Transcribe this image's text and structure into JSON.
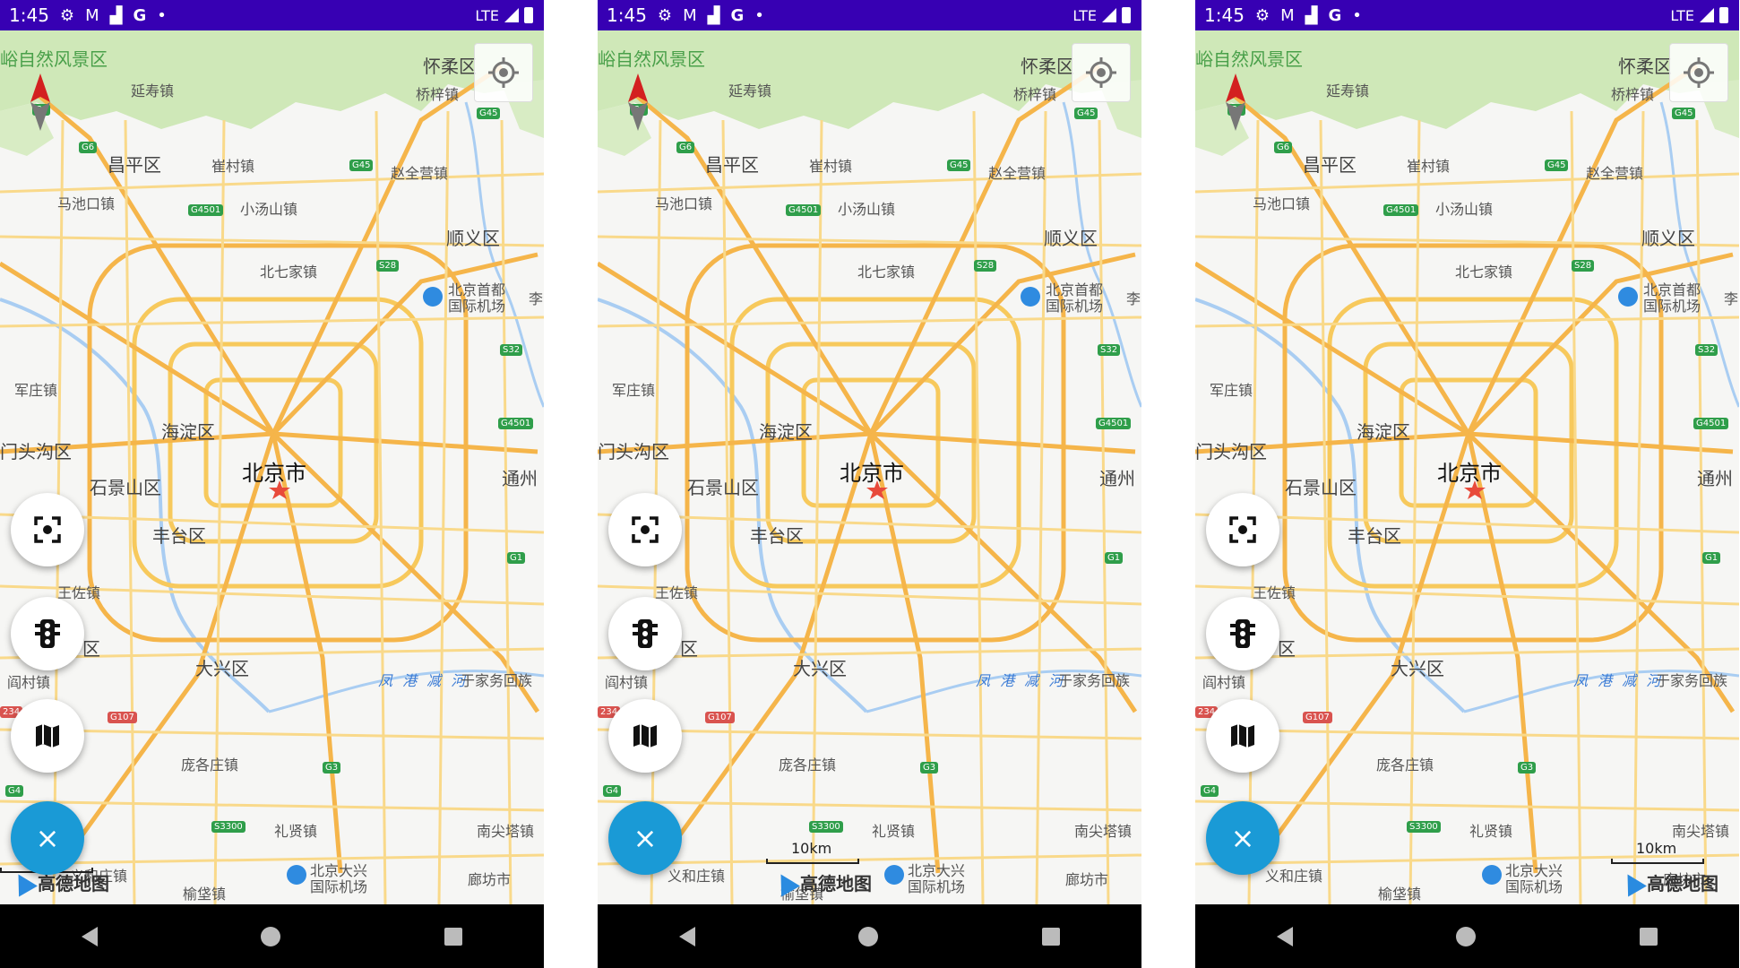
{
  "phones": [
    {
      "id": "phone-1",
      "status_time": "1:45",
      "network": "LTE",
      "scale_label": "",
      "show_scale_text": false
    },
    {
      "id": "phone-2",
      "status_time": "1:45",
      "network": "LTE",
      "scale_label": "10km",
      "show_scale_text": true
    },
    {
      "id": "phone-3",
      "status_time": "1:45",
      "network": "LTE",
      "scale_label": "10km",
      "show_scale_text": true
    }
  ],
  "map": {
    "center_city": "北京市",
    "logo_text": "高德地图",
    "labels": {
      "huairou": "怀柔区",
      "yanshou": "延寿镇",
      "qiaozi": "桥梓镇",
      "changping": "昌平区",
      "cuicun": "崔村镇",
      "zhaoquanying": "赵全营镇",
      "machikou": "马池口镇",
      "xiaotangshan": "小汤山镇",
      "shunyi": "顺义区",
      "beiqijia": "北七家镇",
      "airport1": "北京首都",
      "airport1b": "国际机场",
      "junzhuang": "军庄镇",
      "haidian": "海淀区",
      "mentougou": "门头沟区",
      "shijingshan": "石景山区",
      "tongzhou": "通州",
      "fengtai": "丰台区",
      "wangzuo": "王佐镇",
      "daxing": "大兴区",
      "fenggang": "凤 港 减 河",
      "yujiawu": "于家务回族",
      "yancun": "阎村镇",
      "pangezhuang": "庞各庄镇",
      "lixian": "礼贤镇",
      "nanjianta": "南尖塔镇",
      "yihezhuang": "义和庄镇",
      "airport2": "北京大兴",
      "airport2b": "国际机场",
      "yufa": "榆垡镇",
      "langfang": "廊坊市",
      "scenic": "峪自然风景区",
      "li": "李",
      "qu": "区",
      "zhen": "镇"
    },
    "shields": {
      "g6a": "G6",
      "g6b": "G6",
      "g45a": "G45",
      "g45b": "G45",
      "g4501a": "G4501",
      "s28": "S28",
      "s32": "S32",
      "g4501b": "G4501",
      "g1": "G1",
      "g107": "G107",
      "g3": "G3",
      "s3300": "S3300",
      "g4": "G4",
      "n234": "234"
    },
    "accent_color": "#1a9ad6",
    "status_bar_color": "#3700b3"
  },
  "controls": {
    "locate_icon": "locate-icon",
    "screenshot_icon": "focus-screenshot-icon",
    "traffic_icon": "traffic-light-icon",
    "maptype_icon": "map-icon",
    "close_icon": "close-icon",
    "close_symbol": "×"
  }
}
